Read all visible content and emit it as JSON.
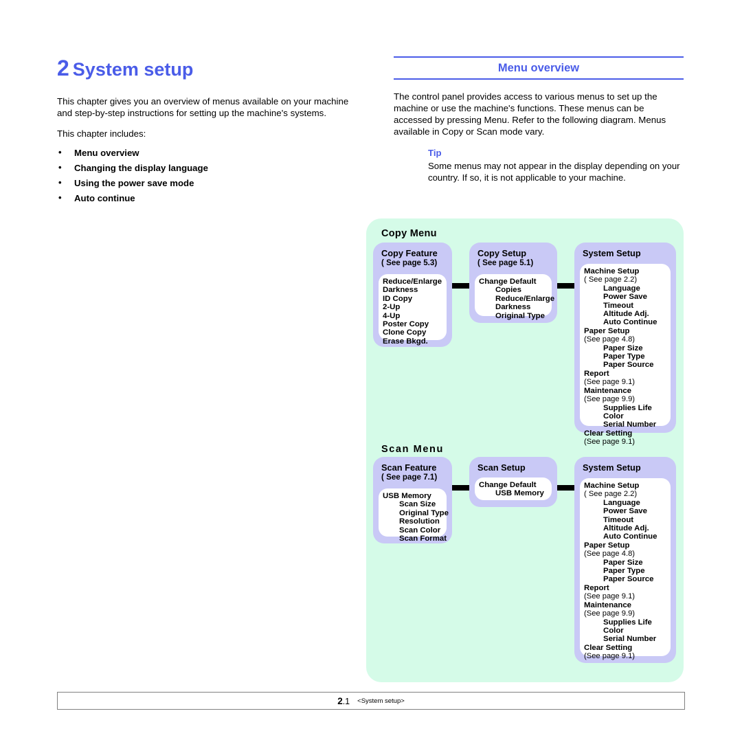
{
  "chapter": {
    "number": "2",
    "title": "System setup",
    "intro": "This chapter gives you an overview of menus available on your machine and step-by-step instructions for setting up the machine's systems.",
    "includes_label": "This chapter includes:",
    "includes": [
      "Menu overview",
      "Changing the display language",
      "Using the power save mode",
      "Auto continue"
    ]
  },
  "section": {
    "title": "Menu overview",
    "body": "The control panel provides access to various menus to set up the machine or use the machine's functions. These menus can be accessed by pressing Menu. Refer to the following diagram. Menus available in Copy or Scan mode vary.",
    "tip": {
      "label": "Tip",
      "text": "Some menus may not appear in the display depending on your country. If so, it is not applicable to your machine."
    }
  },
  "diagram": {
    "copy_group_label": "Copy Menu",
    "scan_group_label": "Scan  Menu",
    "copy_feature": {
      "title": "Copy Feature",
      "page_ref": "( See page 5.3)",
      "items": [
        "Reduce/Enlarge",
        "Darkness",
        "ID Copy",
        "2-Up",
        "4-Up",
        "Poster Copy",
        "Clone Copy",
        "Erase Bkgd."
      ]
    },
    "copy_setup": {
      "title": "Copy Setup",
      "page_ref": "( See page 5.1)",
      "root": "Change Default",
      "items": [
        "Copies",
        "Reduce/Enlarge",
        "Darkness",
        "Original Type"
      ]
    },
    "scan_feature": {
      "title": "Scan Feature",
      "page_ref": "( See page 7.1)",
      "root": "USB Memory",
      "items": [
        "Scan Size",
        "Original Type",
        "Resolution",
        "Scan Color",
        "Scan Format"
      ]
    },
    "scan_setup": {
      "title": "Scan Setup",
      "root": "Change Default",
      "items": [
        "USB Memory"
      ]
    },
    "system_setup": {
      "title": "System Setup",
      "machine_setup": "Machine Setup",
      "machine_setup_ref": "( See page 2.2)",
      "machine_setup_items": [
        "Language",
        "Power Save",
        "Timeout",
        "Altitude Adj.",
        "Auto Continue"
      ],
      "paper_setup": "Paper Setup",
      "paper_setup_ref": "(See page 4.8)",
      "paper_setup_items": [
        "Paper Size",
        "Paper Type",
        "Paper Source"
      ],
      "report": "Report",
      "report_ref": "(See page 9.1)",
      "maintenance": "Maintenance",
      "maintenance_ref": "(See page  9.9)",
      "maintenance_items": [
        "Supplies Life",
        "Color",
        "Serial Number"
      ],
      "clear_setting": "Clear Setting",
      "clear_setting_ref": "(See page  9.1)"
    }
  },
  "footer": {
    "page_major": "2",
    "page_minor": ".1",
    "label": "<System setup>"
  },
  "colors": {
    "accent_blue": "#4a5ce8",
    "diagram_bg": "#d5fbe8",
    "node_bg": "#c9c9f6",
    "node_body_bg": "#ffffff",
    "connector": "#000000"
  }
}
